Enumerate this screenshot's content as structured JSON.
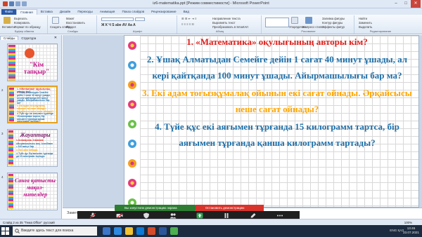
{
  "window": {
    "title": "iz6-matematika.ppt [Режим совместимости] - Microsoft PowerPoint",
    "controls": [
      "–",
      "□",
      "✕"
    ]
  },
  "ribbon": {
    "tabs": [
      "Файл",
      "Главная",
      "Вставка",
      "Дизайн",
      "Переходы",
      "Анимация",
      "Показ слайдов",
      "Рецензирование",
      "Вид"
    ],
    "active_tab": "Главная",
    "clipboard": {
      "paste": "Вставить",
      "cut": "Вырезать",
      "copy": "Копировать",
      "format": "Формат по образцу",
      "label": "Буфер обмена"
    },
    "slides": {
      "new": "Создать слайд",
      "layout": "Макет",
      "reset": "Восстановить",
      "section": "Раздел",
      "label": "Слайды"
    },
    "font": {
      "label": "Шрифт"
    },
    "paragraph": {
      "direction": "Направление текста",
      "align": "Выровнять текст",
      "smartart": "Преобразовать в SmartArt",
      "label": "Абзац"
    },
    "drawing": {
      "arrange": "Упорядочить",
      "quick": "Экспресс-стили",
      "fill": "Заливка фигуры",
      "outline": "Контур фигуры",
      "effects": "Эффекты фигур",
      "label": "Рисование"
    },
    "editing": {
      "find": "Найти",
      "replace": "Заменить",
      "select": "Выделить",
      "label": "Редактирование"
    }
  },
  "left_pane": {
    "tabs": [
      "Слайды",
      "Структура"
    ],
    "close": "✕",
    "slides": [
      {
        "num": "",
        "title": "\"Кім тапқыр\""
      },
      {
        "num": "2",
        "lines": [
          "1. «Математика» оқулығының авторы кім?",
          "2. Ұшақ Алматыдан Семейге дейін 1 сағат 40 минут ұшады, ал кері қайтқанда 100 минут ұшады. Айырмашылығы бар ма?",
          "3. Екі адам тоғызқұмалақ ойынын екі сағат ойнады. Әрқайсысы неше сағат ойнады?",
          "4. Түйе құс екі аяғымен тұрғанда 15 килограмм тартса, бір аяғымен тұрғанда қанша килограмм тартады?"
        ]
      },
      {
        "num": "3",
        "title": "Жауаптары",
        "lines": [
          "1.Оспанкулов. 2.Шапаев",
          "Айырмашылығы жоқ. 1сағ40мин = 100 минут бар",
          "3. Екі сағат ойнады",
          "4. Түйе құс бір аяғымен тұрғанда да 15 килограмм тартады"
        ]
      },
      {
        "num": "4",
        "title": "Санға қатысты мақал-мәтелдер"
      }
    ]
  },
  "slide": {
    "q1_prefix": "1.   «",
    "q1_quoted": "Математика",
    "q1_suffix": "» оқулығының авторы кім?",
    "q2": "2. Ұшақ Алматыдан Семейге дейін  1 сағат 40 минут ұшады, ал кері қайтқанда 100 минут ұшады. Айырмашылығы бар ма?",
    "q3": "3. Екі адам тоғызқұмалақ ойынын екі сағат ойнады. Әрқайсысы неше сағат ойнады?",
    "q4": "4. Түйе құс екі аяғымен тұрғанда 15 килограмм тартса,  бір аяғымен тұрғанда қанша  килограмм тартады?"
  },
  "notes": {
    "label": "Заметк"
  },
  "statusbar": {
    "slide_info": "Слайд 2 из 35",
    "theme": "\"Тема Office\"",
    "language": "русский",
    "zoom": "100%"
  },
  "zoom_meeting": {
    "sharing": "Вы запустили демонстрацию экрана",
    "stop": "Остановить демонстрацию",
    "buttons": [
      {
        "label": "Включить зв",
        "icon": "microphone-icon"
      },
      {
        "label": "Включить вид",
        "icon": "video-icon"
      },
      {
        "label": "Безопасность",
        "icon": "shield-icon"
      },
      {
        "label": "Участники",
        "icon": "participants-icon",
        "count": "1"
      },
      {
        "label": "Новая демон",
        "icon": "share-screen-icon"
      },
      {
        "label": "Пауза демонс",
        "icon": "pause-icon"
      },
      {
        "label": "Комментар",
        "icon": "annotate-icon"
      },
      {
        "label": "Дополнит",
        "icon": "more-icon"
      }
    ]
  },
  "taskbar": {
    "search_placeholder": "Введите здесь текст для поиска",
    "language": "ENG",
    "keyboard": "ҚАЗ",
    "time": "13:45",
    "date": "23.07.2021"
  },
  "colors": {
    "q_red": "#e0201b",
    "q_blue": "#1f6fa8",
    "q_orange": "#ffa500",
    "ribbon": "#dfe8f5"
  }
}
